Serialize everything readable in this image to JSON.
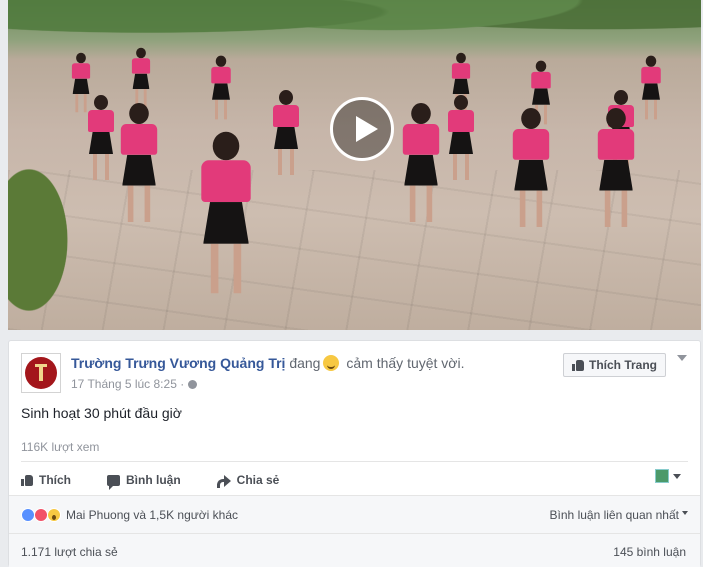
{
  "video": {
    "thumbnail": "schoolchildren-in-pink-uniforms-exercising",
    "play_icon": "play-icon"
  },
  "post": {
    "page_name": "Trường Trưng Vương Quảng Trị",
    "feeling_prefix": "đang",
    "feeling_emoji": "slightly-smiling-emoji",
    "feeling_text": "cảm thấy tuyệt vời.",
    "timestamp": "17 Tháng 5 lúc 8:25 ·",
    "privacy_icon": "globe-icon",
    "like_page_label": "Thích Trang",
    "text": "Sinh hoạt 30 phút đầu giờ",
    "views": "116K lượt xem"
  },
  "actions": {
    "like": "Thích",
    "comment": "Bình luận",
    "share": "Chia sẻ"
  },
  "reactions": {
    "summary": "Mai Phuong và 1,5K người khác",
    "types": [
      "like",
      "love",
      "wow"
    ],
    "sort_label": "Bình luận liên quan nhất"
  },
  "stats": {
    "shares": "1.171 lượt chia sẻ",
    "comments": "145 bình luận"
  },
  "colors": {
    "link": "#365899",
    "like": "#5890ff",
    "love": "#f25268",
    "background": "#e9ebee"
  }
}
